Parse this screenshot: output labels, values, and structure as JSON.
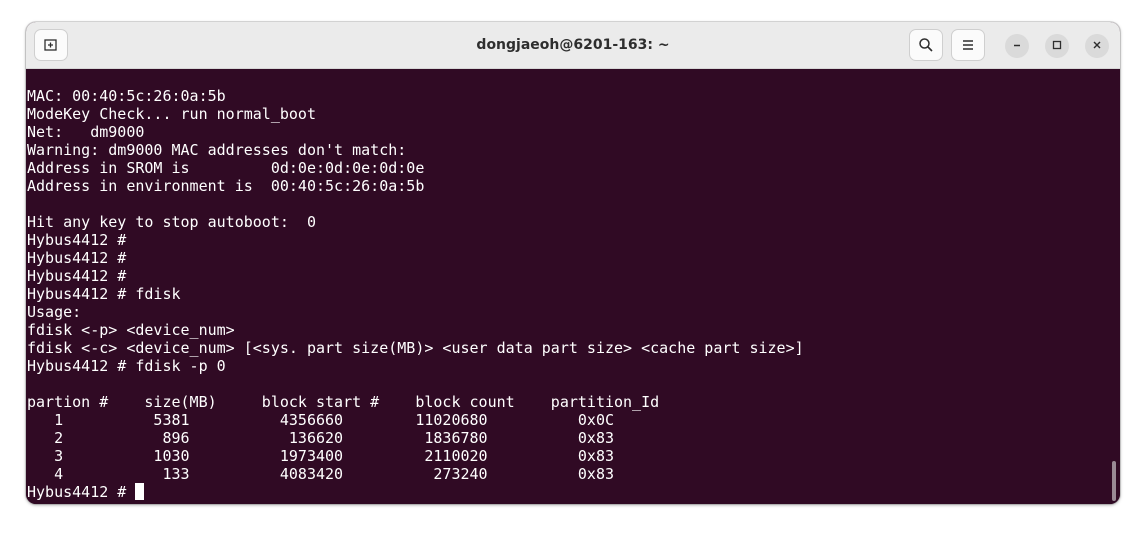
{
  "window": {
    "title": "dongjaeoh@6201-163: ~"
  },
  "titlebar": {
    "new_tab_icon": "new-tab-icon",
    "search_icon": "search-icon",
    "menu_icon": "hamburger-menu-icon",
    "minimize_icon": "minimize-icon",
    "maximize_icon": "maximize-icon",
    "close_icon": "close-icon"
  },
  "terminal": {
    "background": "#300a24",
    "foreground": "#ffffff",
    "lines": [
      "MAC: 00:40:5c:26:0a:5b",
      "ModeKey Check... run normal_boot",
      "Net:   dm9000",
      "Warning: dm9000 MAC addresses don't match:",
      "Address in SROM is         0d:0e:0d:0e:0d:0e",
      "Address in environment is  00:40:5c:26:0a:5b",
      "",
      "Hit any key to stop autoboot:  0",
      "Hybus4412 #",
      "Hybus4412 #",
      "Hybus4412 #",
      "Hybus4412 # fdisk",
      "Usage:",
      "fdisk <-p> <device_num>",
      "fdisk <-c> <device_num> [<sys. part size(MB)> <user data part size> <cache part size>]",
      "Hybus4412 # fdisk -p 0",
      "",
      "partion #    size(MB)     block start #    block count    partition_Id",
      "   1          5381          4356660        11020680          0x0C",
      "   2           896           136620         1836780          0x83",
      "   3          1030          1973400         2110020          0x83",
      "   4           133          4083420          273240          0x83"
    ],
    "prompt": "Hybus4412 # "
  }
}
